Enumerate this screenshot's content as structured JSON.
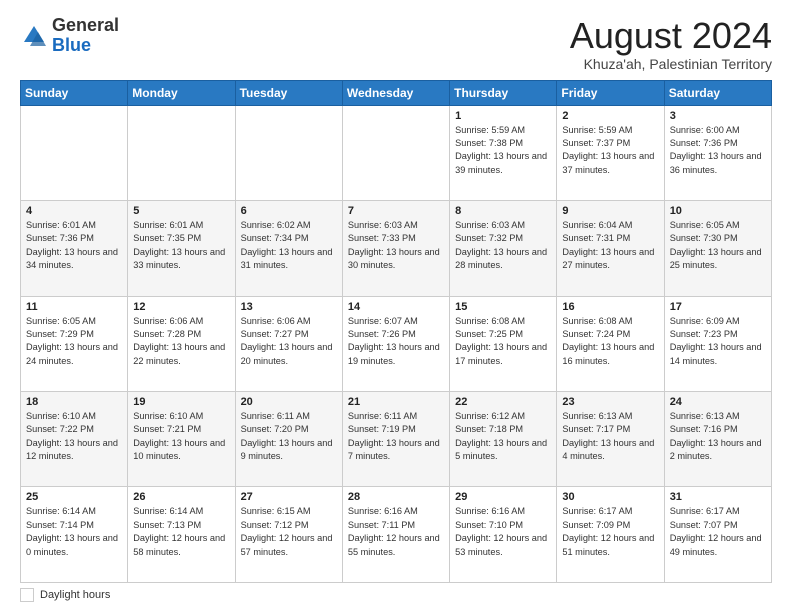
{
  "header": {
    "logo_general": "General",
    "logo_blue": "Blue",
    "month_title": "August 2024",
    "subtitle": "Khuza'ah, Palestinian Territory"
  },
  "days_of_week": [
    "Sunday",
    "Monday",
    "Tuesday",
    "Wednesday",
    "Thursday",
    "Friday",
    "Saturday"
  ],
  "weeks": [
    [
      {
        "day": "",
        "sunrise": "",
        "sunset": "",
        "daylight": ""
      },
      {
        "day": "",
        "sunrise": "",
        "sunset": "",
        "daylight": ""
      },
      {
        "day": "",
        "sunrise": "",
        "sunset": "",
        "daylight": ""
      },
      {
        "day": "",
        "sunrise": "",
        "sunset": "",
        "daylight": ""
      },
      {
        "day": "1",
        "sunrise": "Sunrise: 5:59 AM",
        "sunset": "Sunset: 7:38 PM",
        "daylight": "Daylight: 13 hours and 39 minutes."
      },
      {
        "day": "2",
        "sunrise": "Sunrise: 5:59 AM",
        "sunset": "Sunset: 7:37 PM",
        "daylight": "Daylight: 13 hours and 37 minutes."
      },
      {
        "day": "3",
        "sunrise": "Sunrise: 6:00 AM",
        "sunset": "Sunset: 7:36 PM",
        "daylight": "Daylight: 13 hours and 36 minutes."
      }
    ],
    [
      {
        "day": "4",
        "sunrise": "Sunrise: 6:01 AM",
        "sunset": "Sunset: 7:36 PM",
        "daylight": "Daylight: 13 hours and 34 minutes."
      },
      {
        "day": "5",
        "sunrise": "Sunrise: 6:01 AM",
        "sunset": "Sunset: 7:35 PM",
        "daylight": "Daylight: 13 hours and 33 minutes."
      },
      {
        "day": "6",
        "sunrise": "Sunrise: 6:02 AM",
        "sunset": "Sunset: 7:34 PM",
        "daylight": "Daylight: 13 hours and 31 minutes."
      },
      {
        "day": "7",
        "sunrise": "Sunrise: 6:03 AM",
        "sunset": "Sunset: 7:33 PM",
        "daylight": "Daylight: 13 hours and 30 minutes."
      },
      {
        "day": "8",
        "sunrise": "Sunrise: 6:03 AM",
        "sunset": "Sunset: 7:32 PM",
        "daylight": "Daylight: 13 hours and 28 minutes."
      },
      {
        "day": "9",
        "sunrise": "Sunrise: 6:04 AM",
        "sunset": "Sunset: 7:31 PM",
        "daylight": "Daylight: 13 hours and 27 minutes."
      },
      {
        "day": "10",
        "sunrise": "Sunrise: 6:05 AM",
        "sunset": "Sunset: 7:30 PM",
        "daylight": "Daylight: 13 hours and 25 minutes."
      }
    ],
    [
      {
        "day": "11",
        "sunrise": "Sunrise: 6:05 AM",
        "sunset": "Sunset: 7:29 PM",
        "daylight": "Daylight: 13 hours and 24 minutes."
      },
      {
        "day": "12",
        "sunrise": "Sunrise: 6:06 AM",
        "sunset": "Sunset: 7:28 PM",
        "daylight": "Daylight: 13 hours and 22 minutes."
      },
      {
        "day": "13",
        "sunrise": "Sunrise: 6:06 AM",
        "sunset": "Sunset: 7:27 PM",
        "daylight": "Daylight: 13 hours and 20 minutes."
      },
      {
        "day": "14",
        "sunrise": "Sunrise: 6:07 AM",
        "sunset": "Sunset: 7:26 PM",
        "daylight": "Daylight: 13 hours and 19 minutes."
      },
      {
        "day": "15",
        "sunrise": "Sunrise: 6:08 AM",
        "sunset": "Sunset: 7:25 PM",
        "daylight": "Daylight: 13 hours and 17 minutes."
      },
      {
        "day": "16",
        "sunrise": "Sunrise: 6:08 AM",
        "sunset": "Sunset: 7:24 PM",
        "daylight": "Daylight: 13 hours and 16 minutes."
      },
      {
        "day": "17",
        "sunrise": "Sunrise: 6:09 AM",
        "sunset": "Sunset: 7:23 PM",
        "daylight": "Daylight: 13 hours and 14 minutes."
      }
    ],
    [
      {
        "day": "18",
        "sunrise": "Sunrise: 6:10 AM",
        "sunset": "Sunset: 7:22 PM",
        "daylight": "Daylight: 13 hours and 12 minutes."
      },
      {
        "day": "19",
        "sunrise": "Sunrise: 6:10 AM",
        "sunset": "Sunset: 7:21 PM",
        "daylight": "Daylight: 13 hours and 10 minutes."
      },
      {
        "day": "20",
        "sunrise": "Sunrise: 6:11 AM",
        "sunset": "Sunset: 7:20 PM",
        "daylight": "Daylight: 13 hours and 9 minutes."
      },
      {
        "day": "21",
        "sunrise": "Sunrise: 6:11 AM",
        "sunset": "Sunset: 7:19 PM",
        "daylight": "Daylight: 13 hours and 7 minutes."
      },
      {
        "day": "22",
        "sunrise": "Sunrise: 6:12 AM",
        "sunset": "Sunset: 7:18 PM",
        "daylight": "Daylight: 13 hours and 5 minutes."
      },
      {
        "day": "23",
        "sunrise": "Sunrise: 6:13 AM",
        "sunset": "Sunset: 7:17 PM",
        "daylight": "Daylight: 13 hours and 4 minutes."
      },
      {
        "day": "24",
        "sunrise": "Sunrise: 6:13 AM",
        "sunset": "Sunset: 7:16 PM",
        "daylight": "Daylight: 13 hours and 2 minutes."
      }
    ],
    [
      {
        "day": "25",
        "sunrise": "Sunrise: 6:14 AM",
        "sunset": "Sunset: 7:14 PM",
        "daylight": "Daylight: 13 hours and 0 minutes."
      },
      {
        "day": "26",
        "sunrise": "Sunrise: 6:14 AM",
        "sunset": "Sunset: 7:13 PM",
        "daylight": "Daylight: 12 hours and 58 minutes."
      },
      {
        "day": "27",
        "sunrise": "Sunrise: 6:15 AM",
        "sunset": "Sunset: 7:12 PM",
        "daylight": "Daylight: 12 hours and 57 minutes."
      },
      {
        "day": "28",
        "sunrise": "Sunrise: 6:16 AM",
        "sunset": "Sunset: 7:11 PM",
        "daylight": "Daylight: 12 hours and 55 minutes."
      },
      {
        "day": "29",
        "sunrise": "Sunrise: 6:16 AM",
        "sunset": "Sunset: 7:10 PM",
        "daylight": "Daylight: 12 hours and 53 minutes."
      },
      {
        "day": "30",
        "sunrise": "Sunrise: 6:17 AM",
        "sunset": "Sunset: 7:09 PM",
        "daylight": "Daylight: 12 hours and 51 minutes."
      },
      {
        "day": "31",
        "sunrise": "Sunrise: 6:17 AM",
        "sunset": "Sunset: 7:07 PM",
        "daylight": "Daylight: 12 hours and 49 minutes."
      }
    ]
  ],
  "footer": {
    "daylight_label": "Daylight hours"
  }
}
